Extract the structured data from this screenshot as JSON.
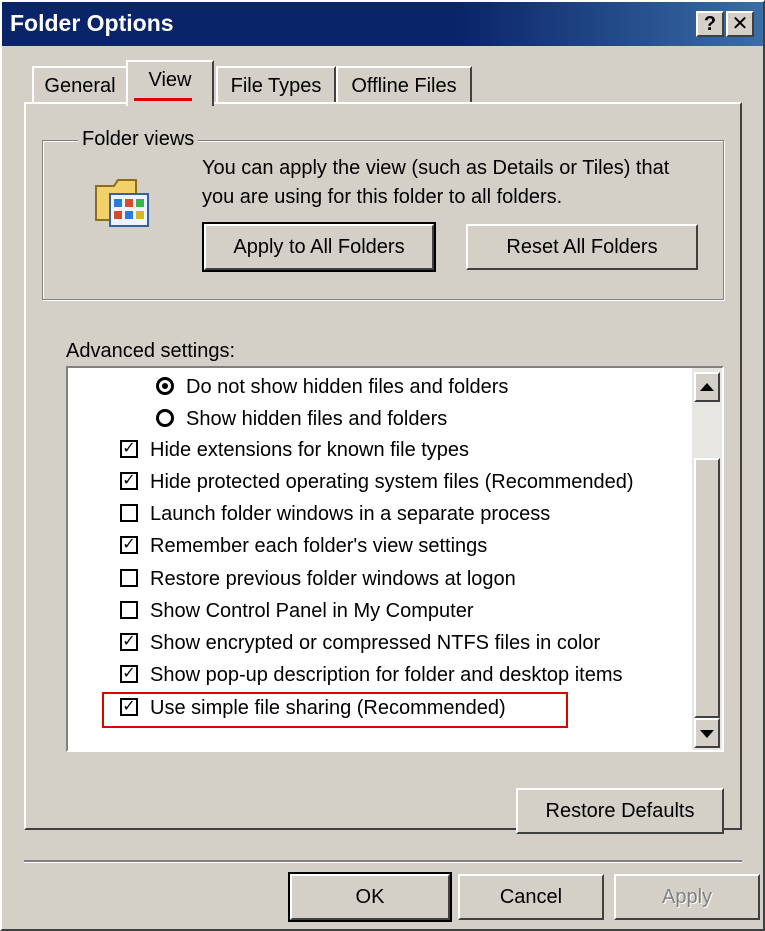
{
  "window": {
    "title": "Folder Options",
    "help_label": "?",
    "close_label": "✕"
  },
  "tabs": [
    {
      "label": "General"
    },
    {
      "label": "View"
    },
    {
      "label": "File Types"
    },
    {
      "label": "Offline Files"
    }
  ],
  "folder_views": {
    "title": "Folder views",
    "description_line1": "You can apply the view (such as Details or Tiles) that",
    "description_line2": "you are using for this folder to all folders.",
    "apply_button": "Apply to All Folders",
    "reset_button": "Reset All Folders"
  },
  "advanced": {
    "label": "Advanced settings:",
    "items": [
      {
        "type": "radio",
        "checked": true,
        "label": "Do not show hidden files and folders"
      },
      {
        "type": "radio",
        "checked": false,
        "label": "Show hidden files and folders"
      },
      {
        "type": "checkbox",
        "checked": true,
        "label": "Hide extensions for known file types"
      },
      {
        "type": "checkbox",
        "checked": true,
        "label": "Hide protected operating system files (Recommended)"
      },
      {
        "type": "checkbox",
        "checked": false,
        "label": "Launch folder windows in a separate process"
      },
      {
        "type": "checkbox",
        "checked": true,
        "label": "Remember each folder's view settings"
      },
      {
        "type": "checkbox",
        "checked": false,
        "label": "Restore previous folder windows at logon"
      },
      {
        "type": "checkbox",
        "checked": false,
        "label": "Show Control Panel in My Computer"
      },
      {
        "type": "checkbox",
        "checked": true,
        "label": "Show encrypted or compressed NTFS files in color"
      },
      {
        "type": "checkbox",
        "checked": true,
        "label": "Show pop-up description for folder and desktop items"
      },
      {
        "type": "checkbox",
        "checked": true,
        "label": "Use simple file sharing (Recommended)"
      }
    ]
  },
  "buttons": {
    "restore_defaults": "Restore Defaults",
    "ok": "OK",
    "cancel": "Cancel",
    "apply": "Apply"
  },
  "colors": {
    "titlebar": "#0a246a",
    "face": "#d4d0c8",
    "highlight_box": "#e00000"
  }
}
